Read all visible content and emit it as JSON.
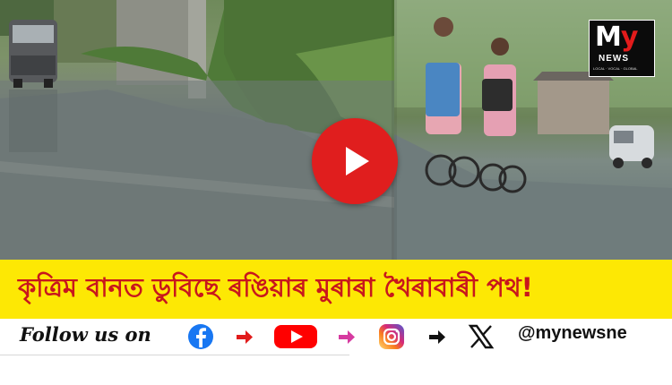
{
  "thumbnail": {
    "headline": "কৃত্ৰিম বানত ডুবিছে ৰঙিয়াৰ মুৰাৰা খৈৰাবাৰী পথ!",
    "play_icon": "play-icon"
  },
  "logo": {
    "main_m": "M",
    "main_y": "y",
    "sub": "NEWS",
    "tagline": "LOCAL · VOCAL · GLOBAL"
  },
  "follow_bar": {
    "text": "Follow us on",
    "handle": "@mynewsne",
    "icons": [
      "facebook-icon",
      "youtube-icon",
      "instagram-icon",
      "x-icon"
    ]
  },
  "colors": {
    "headline_band": "#fde804",
    "headline_text": "#c8161d",
    "play_button": "#e01e1e"
  }
}
